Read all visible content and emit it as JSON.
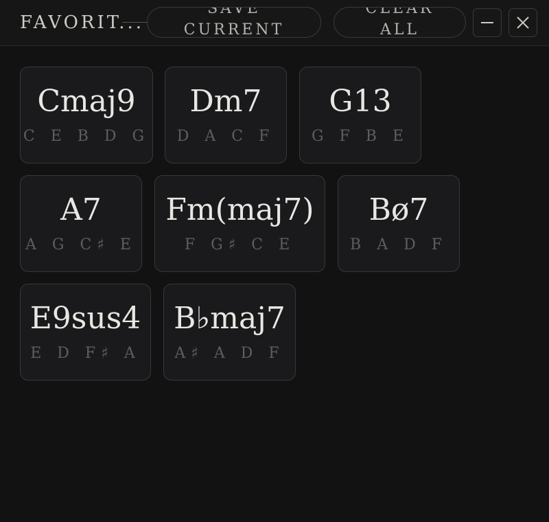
{
  "header": {
    "title": "FAVORIT...",
    "save_label": "SAVE\nCURRENT",
    "clear_label": "CLEAR\nALL",
    "minimize_icon": "minus-icon",
    "close_icon": "close-icon"
  },
  "chords": [
    {
      "name": "Cmaj9",
      "notes": "C E B D G"
    },
    {
      "name": "Dm7",
      "notes": "D A C F"
    },
    {
      "name": "G13",
      "notes": "G F B E"
    },
    {
      "name": "A7",
      "notes": "A G C♯ E"
    },
    {
      "name": "Fm(maj7)",
      "notes": "F G♯ C E"
    },
    {
      "name": "Bø7",
      "notes": "B A D F"
    },
    {
      "name": "E9sus4",
      "notes": "E D F♯ A"
    },
    {
      "name": "B♭maj7",
      "notes": "A♯ A D F"
    }
  ]
}
